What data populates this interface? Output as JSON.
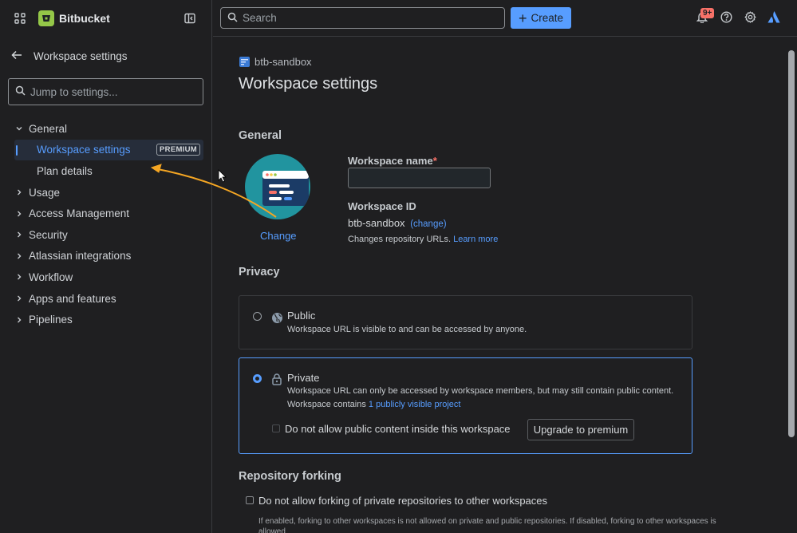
{
  "colors": {
    "accent": "#579dff",
    "annotation_arrow": "#f5a623",
    "logo": "#94c748",
    "notification": "#f87168"
  },
  "topbar": {
    "app_name": "Bitbucket",
    "search_placeholder": "Search",
    "create_label": "Create",
    "notification_count": "9+",
    "icons": [
      "apps-grid-icon",
      "sidebar-collapse-icon",
      "search-icon",
      "bell-icon",
      "help-icon",
      "gear-icon",
      "atlassian-icon"
    ]
  },
  "sidebar": {
    "title": "Workspace settings",
    "jump_placeholder": "Jump to settings...",
    "groups": [
      {
        "label": "General",
        "expanded": true
      },
      {
        "label": "Usage"
      },
      {
        "label": "Access Management"
      },
      {
        "label": "Security"
      },
      {
        "label": "Atlassian integrations"
      },
      {
        "label": "Workflow"
      },
      {
        "label": "Apps and features"
      },
      {
        "label": "Pipelines"
      }
    ],
    "general_items": [
      {
        "label": "Workspace settings",
        "badge": "PREMIUM",
        "active": true
      },
      {
        "label": "Plan details"
      }
    ]
  },
  "main": {
    "breadcrumb": "btb-sandbox",
    "title": "Workspace settings",
    "general": {
      "heading": "General",
      "change_label": "Change",
      "name_label": "Workspace name",
      "required_mark": "*",
      "name_value": "",
      "id_label": "Workspace ID",
      "id_value": "btb-sandbox",
      "id_change": "(change)",
      "id_note": "Changes repository URLs.",
      "learn_more": "Learn more"
    },
    "privacy": {
      "heading": "Privacy",
      "public_title": "Public",
      "public_desc": "Workspace URL is visible to and can be accessed by anyone.",
      "private_title": "Private",
      "private_desc": "Workspace URL can only be accessed by workspace members, but may still contain public content.",
      "contains_prefix": "Workspace contains",
      "contains_link": "1 publicly visible project",
      "no_public_label": "Do not allow public content inside this workspace",
      "upgrade_label": "Upgrade to premium",
      "selected": "Private"
    },
    "forking": {
      "heading": "Repository forking",
      "checkbox_label": "Do not allow forking of private repositories to other workspaces",
      "note": "If enabled, forking to other workspaces is not allowed on private and public repositories. If disabled, forking to other workspaces is allowed"
    }
  }
}
